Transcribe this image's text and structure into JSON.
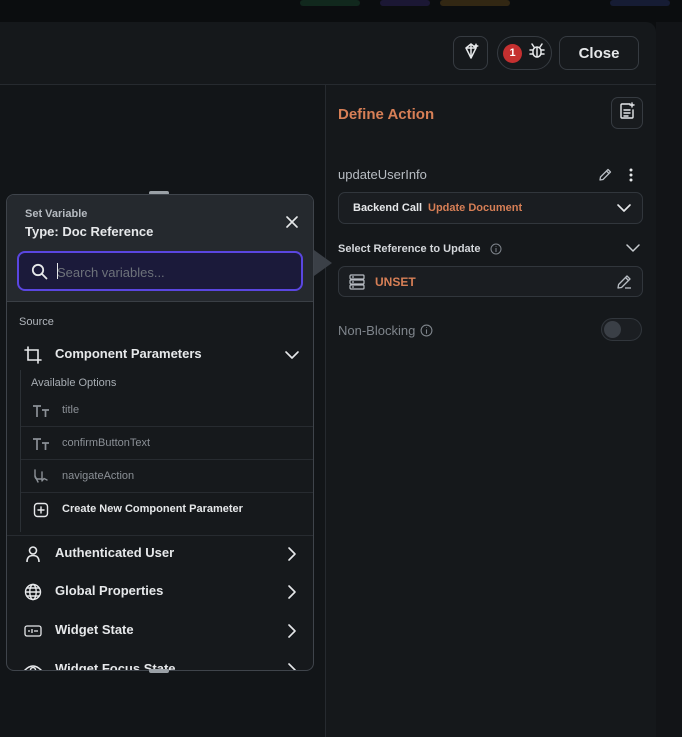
{
  "header": {
    "issues_count": "1",
    "close_label": "Close"
  },
  "define_action": {
    "title": "Define Action",
    "action_name": "updateUserInfo",
    "backend_call_label": "Backend Call",
    "backend_call_value": "Update Document",
    "select_reference_label": "Select Reference to Update",
    "reference_value": "UNSET",
    "non_blocking_label": "Non-Blocking",
    "non_blocking_enabled": false
  },
  "set_variable": {
    "title": "Set Variable",
    "type_label": "Type: Doc Reference",
    "search_placeholder": "Search variables...",
    "source_label": "Source",
    "component_parameters": {
      "label": "Component Parameters",
      "available_label": "Available Options",
      "options": [
        {
          "label": "title",
          "icon": "text-type-icon"
        },
        {
          "label": "confirmButtonText",
          "icon": "text-type-icon"
        },
        {
          "label": "navigateAction",
          "icon": "action-icon"
        }
      ],
      "create_label": "Create New Component Parameter"
    },
    "sources": [
      {
        "label": "Authenticated User",
        "icon": "user-icon"
      },
      {
        "label": "Global Properties",
        "icon": "globe-icon"
      },
      {
        "label": "Widget State",
        "icon": "widget-state-icon"
      },
      {
        "label": "Widget Focus State",
        "icon": "eye-icon"
      }
    ]
  },
  "colors": {
    "accent_orange": "#d77f56",
    "focus_purple": "#5a46e0",
    "badge_red": "#c53030"
  }
}
